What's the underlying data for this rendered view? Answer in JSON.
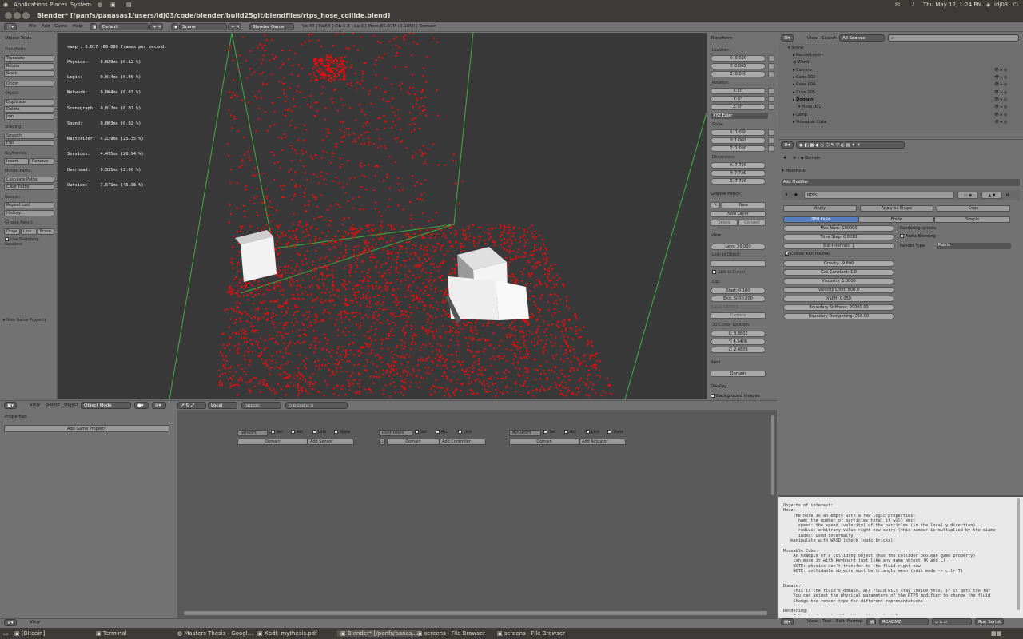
{
  "os": {
    "menu": [
      "Applications",
      "Places",
      "System"
    ],
    "clock": "Thu May 12,  1:24 PM",
    "user": "idj03"
  },
  "window": {
    "title": "Blender* [/panfs/panasas1/users/idj03/code/blender/build25git/blendfiles/rtps_hose_collide.blend]"
  },
  "header": {
    "menus": [
      "File",
      "Add",
      "Game",
      "Help"
    ],
    "layout": "Default",
    "scene": "Scene",
    "engine": "Blender Game",
    "stats": "Ve:40 | Fa:54 | Ob:1-8 | La:1 | Mem:65.07M (0.10M) | Domain"
  },
  "toolshelf": {
    "title": "Object Tools",
    "transform": "Transform:",
    "translate": "Translate",
    "rotate": "Rotate",
    "scale": "Scale",
    "origin": "Origin",
    "object": "Object:",
    "duplicate": "Duplicate",
    "delete": "Delete",
    "join": "Join",
    "shading": "Shading:",
    "smooth": "Smooth",
    "flat": "Flat",
    "keyframes": "Keyframes:",
    "insert": "Insert",
    "remove": "Remove",
    "motion": "Motion Paths:",
    "calc": "Calculate Paths",
    "clear": "Clear Paths",
    "repeat": "Repeat:",
    "repeat_last": "Repeat Last",
    "history": "History...",
    "gp": "Grease Pencil:",
    "draw": "Draw",
    "line": "Line",
    "erase": "Erase",
    "sketch": "Use Sketching Sessions",
    "new_prop": "New Game Property"
  },
  "profile": [
    "swap : 0.017 (60.080 frames per second)",
    "Physics:     0.020ms (0.12 %)",
    "Logic:       0.014ms (0.09 %)",
    "Network:     0.004ms (0.03 %)",
    "Scenegraph:  0.012ms (0.07 %)",
    "Sound:       0.003ms (0.02 %)",
    "Rasterizer:  4.229ms (25.35 %)",
    "Services:    4.495ms (26.94 %)",
    "Overhead:    0.335ms (2.00 %)",
    "Outside:     7.571ms (45.38 %)"
  ],
  "npanel": {
    "transform": "Transform",
    "location": "Location:",
    "lx": "X: 0.000",
    "ly": "Y: 0.000",
    "lz": "Z: 0.000",
    "rotation": "Rotation:",
    "rx": "X: 0°",
    "ry": "Y: 0°",
    "rz": "Z: 0°",
    "euler": "XYZ Euler",
    "scale": "Scale:",
    "sx": "X: 1.000",
    "sy": "Y: 1.000",
    "sz": "Z: 1.000",
    "dims": "Dimensions:",
    "dx": "X: 7.726",
    "dy": "Y: 7.726",
    "dz": "Z: 7.726",
    "gp": "Grease Pencil",
    "gp_new": "New",
    "gp_newlayer": "New Layer",
    "gp_delete": "Delete Frame",
    "gp_convert": "Convert",
    "view": "View",
    "lens": "Lens: 35.000",
    "lock": "Lock to Object:",
    "lock_cursor": "Lock to Cursor",
    "clip": "Clip:",
    "start": "Start: 0.100",
    "end": "End: 5000.000",
    "local_cam": "Local Camera:",
    "camera": "Camera",
    "cursor": "3D Cursor Location:",
    "cx": "X: 3.8802",
    "cy": "Y: 4.5408",
    "cz": "Z: 2.4809",
    "item": "Item",
    "item_name": "Domain",
    "display": "Display",
    "bg_images": "Background Images"
  },
  "vphead": {
    "menus": [
      "View",
      "Select",
      "Object"
    ],
    "mode": "Object Mode",
    "orient": "Local"
  },
  "logic": {
    "properties": "Properties",
    "add_prop": "Add Game Property",
    "sensors": "Sensors",
    "controllers": "Controllers",
    "actuators": "Actuators",
    "sel": "Sel",
    "act": "Act",
    "link": "Link",
    "state": "State",
    "domain": "Domain",
    "add_sensor": "Add Sensor",
    "add_controller": "Add Controller",
    "add_actuator": "Add Actuator",
    "view": "View"
  },
  "outliner": {
    "view": "View",
    "search": "Search",
    "scenes": "All Scenes",
    "items": [
      "Scene",
      "RenderLayers",
      "World",
      "Camera",
      "Cube.002",
      "Cube.004",
      "Cube.005",
      "Domain",
      "Hose.001",
      "Lamp",
      "Moveable Cube"
    ]
  },
  "props": {
    "object": "Domain",
    "modifiers": "Modifiers",
    "add": "Add Modifier",
    "mod_name": "RTPS",
    "apply": "Apply",
    "apply_shape": "Apply as Shape",
    "copy": "Copy",
    "tab_sph": "SPH Fluid",
    "tab_boids": "Boids",
    "tab_simple": "Simple",
    "maxnum": "Max Num: 100000",
    "timestep": "Time Step: 0.0010",
    "subint": "Sub-Intervals: 1",
    "render_opts": "Rendering options",
    "alpha": "Alpha Blending",
    "render_type": "Render Type:",
    "points": "Points",
    "collide": "Collide with meshes",
    "gravity": "Gravity: -9.800",
    "gas": "Gas Constant: 1.0",
    "visc": "Viscosity: 1.0000",
    "vlimit": "Velocity Limit: 600.0",
    "xsph": "XSPH: 0.050",
    "bstiff": "Boundary Stiffness: 20000.00",
    "bdamp": "Boundary Dampening: 256.00"
  },
  "text": {
    "body": "Objects of interest:\nHose:\n    The hose is an empty with a few logic properties:\n      num: the number of particles total it will emit\n      speed: the speed (velocity) of the particles (in the local y direction)\n      radius: arbitrary value right now sorry (this number is multiplied by the diame\n      index: used internally\n   manipulate with WASD (check logic bricks)\n\nMoveable Cube:\n    An example of a colliding object (has the collider boolean game property)\n    can move it with keyboard just like any game object (K and L)\n    NOTE: physics don't transfer to the fluid right now\n    NOTE: collidable objects must be triangle mesh (edit mode -> ctlr-T)\n\n\nDomain:\n    This is the fluid's domain, all fluid will stay inside this, if it gets too far\n    You can adjust the physical parameters of the RTPS modifier to change the fluid\n    Change the render type for different representations\n\nRendering:\n    Color is determined by the active material.",
    "menus": [
      "View",
      "Text",
      "Edit",
      "Format"
    ],
    "file": "README",
    "run": "Run Script"
  },
  "taskbar": [
    "[Bitcoin]",
    "Terminal",
    "Masters Thesis - Googl...",
    "Xpdf: mythesis.pdf",
    "Blender* [/panfs/panas...",
    "screens - File Browser",
    "screens - File Browser"
  ],
  "colors": {
    "particle": "#dd1010",
    "domain_edge": "#3fb13f"
  }
}
